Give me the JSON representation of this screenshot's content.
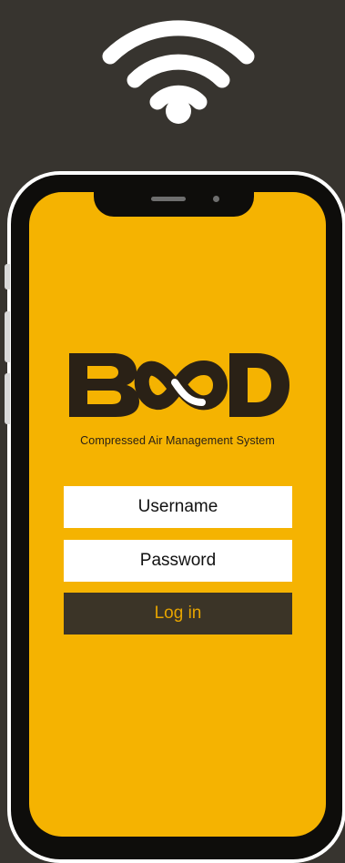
{
  "status": {
    "icon": "wifi-icon"
  },
  "brand": {
    "logo_text": "B X D",
    "tagline": "Compressed Air Management System"
  },
  "login": {
    "username_placeholder": "Username",
    "password_placeholder": "Password",
    "button_label": "Log in"
  },
  "colors": {
    "background": "#37342f",
    "screen": "#f5b301",
    "button": "#3b3427",
    "button_text": "#e6a400",
    "logo": "#2a2116"
  }
}
